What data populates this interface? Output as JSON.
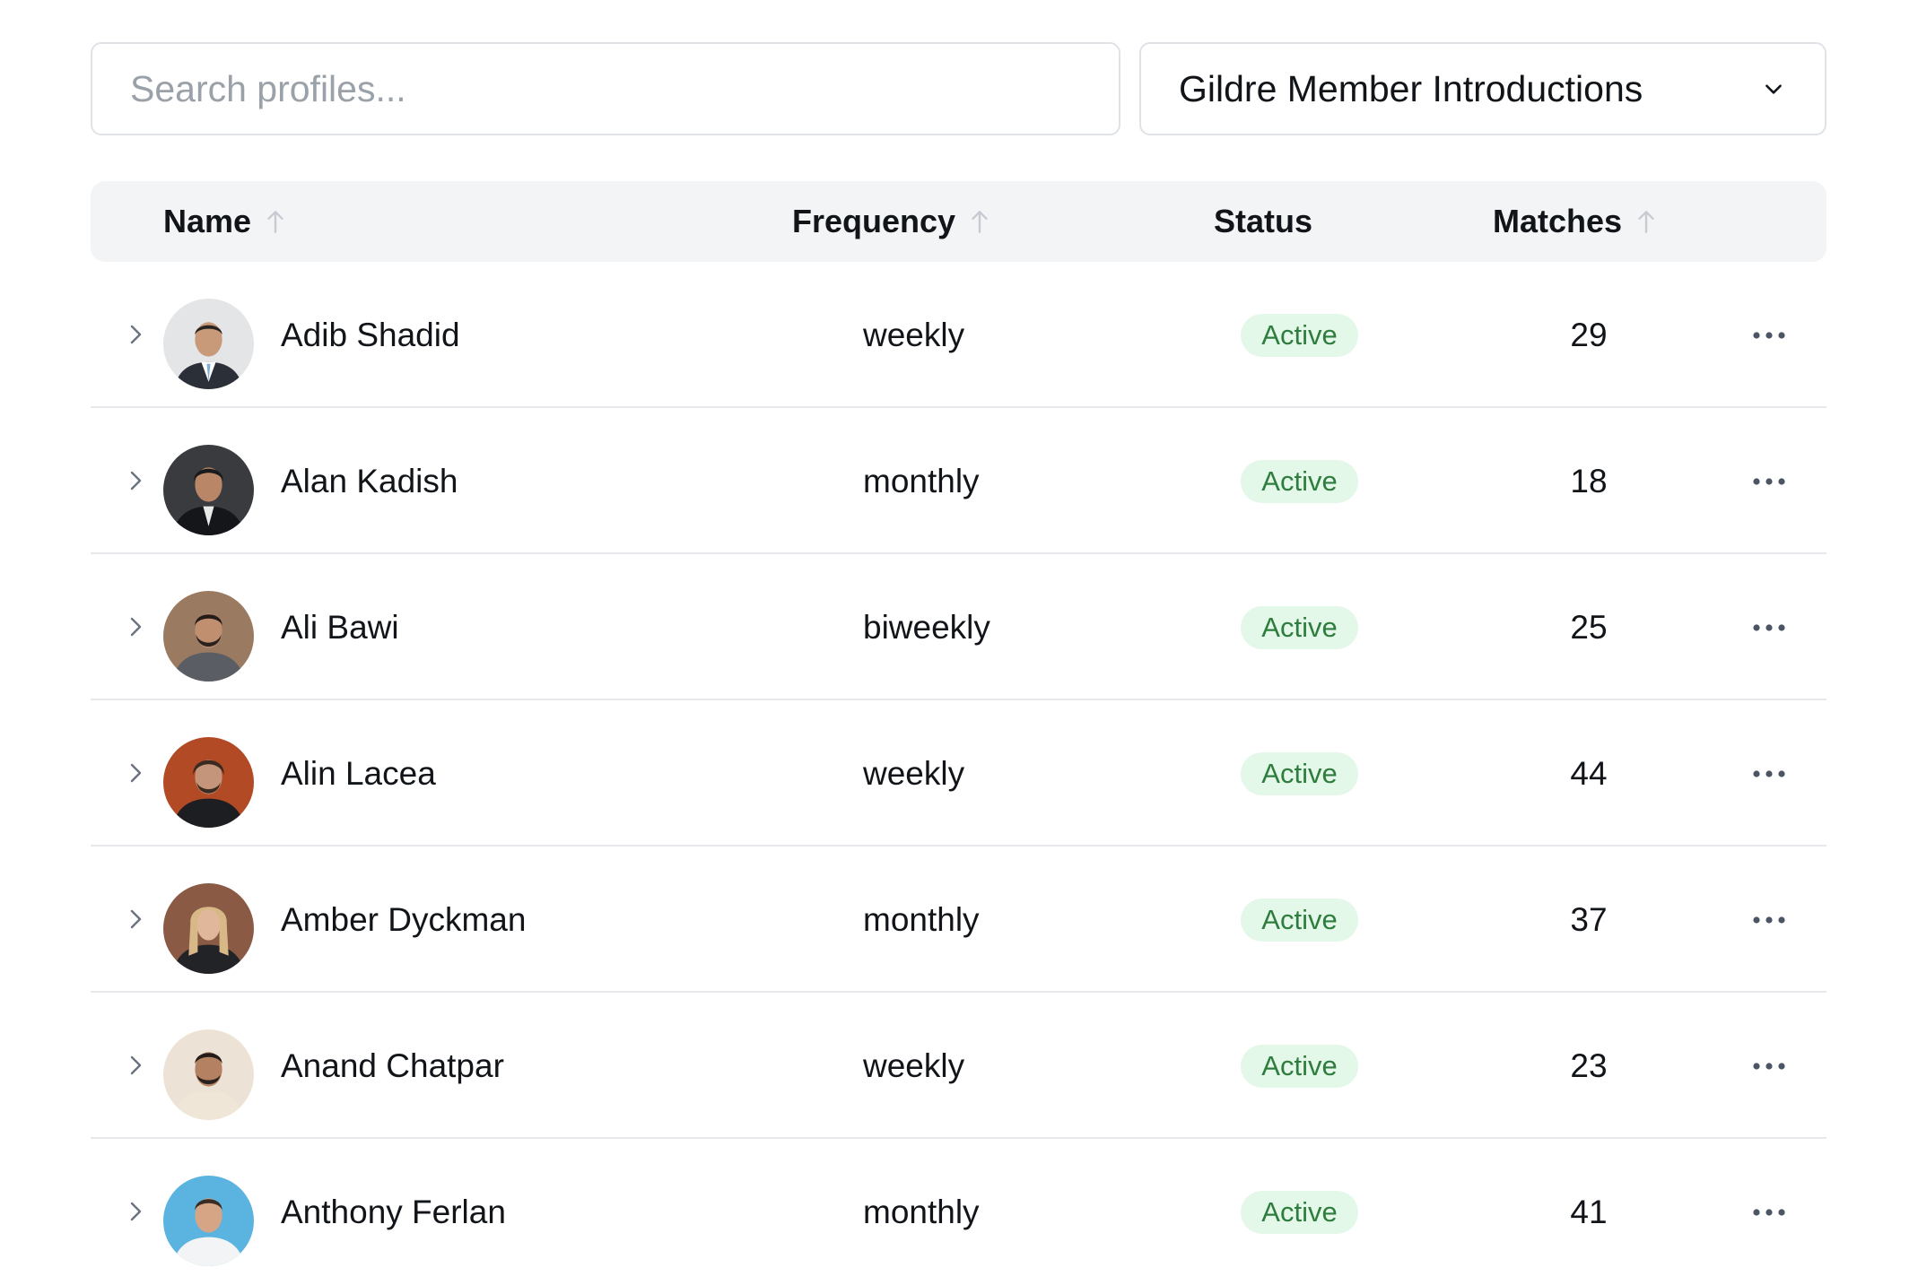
{
  "search": {
    "placeholder": "Search profiles..."
  },
  "program_select": {
    "value": "Gildre Member Introductions"
  },
  "table": {
    "columns": {
      "name": "Name",
      "frequency": "Frequency",
      "status": "Status",
      "matches": "Matches"
    },
    "rows": [
      {
        "name": "Adib Shadid",
        "frequency": "weekly",
        "status": "Active",
        "matches": "29"
      },
      {
        "name": "Alan Kadish",
        "frequency": "monthly",
        "status": "Active",
        "matches": "18"
      },
      {
        "name": "Ali Bawi",
        "frequency": "biweekly",
        "status": "Active",
        "matches": "25"
      },
      {
        "name": "Alin Lacea",
        "frequency": "weekly",
        "status": "Active",
        "matches": "44"
      },
      {
        "name": "Amber Dyckman",
        "frequency": "monthly",
        "status": "Active",
        "matches": "37"
      },
      {
        "name": "Anand Chatpar",
        "frequency": "weekly",
        "status": "Active",
        "matches": "23"
      },
      {
        "name": "Anthony Ferlan",
        "frequency": "monthly",
        "status": "Active",
        "matches": "41"
      }
    ]
  },
  "colors": {
    "active_badge_bg": "#e3f8e8",
    "active_badge_text": "#2f7d3e",
    "header_bg": "#f3f4f6",
    "border": "#e6e8eb"
  },
  "icons": {
    "sort": "arrow-up-icon",
    "expand": "chevron-right-icon",
    "dropdown": "chevron-down-icon",
    "row_actions": "more-horizontal-icon"
  }
}
